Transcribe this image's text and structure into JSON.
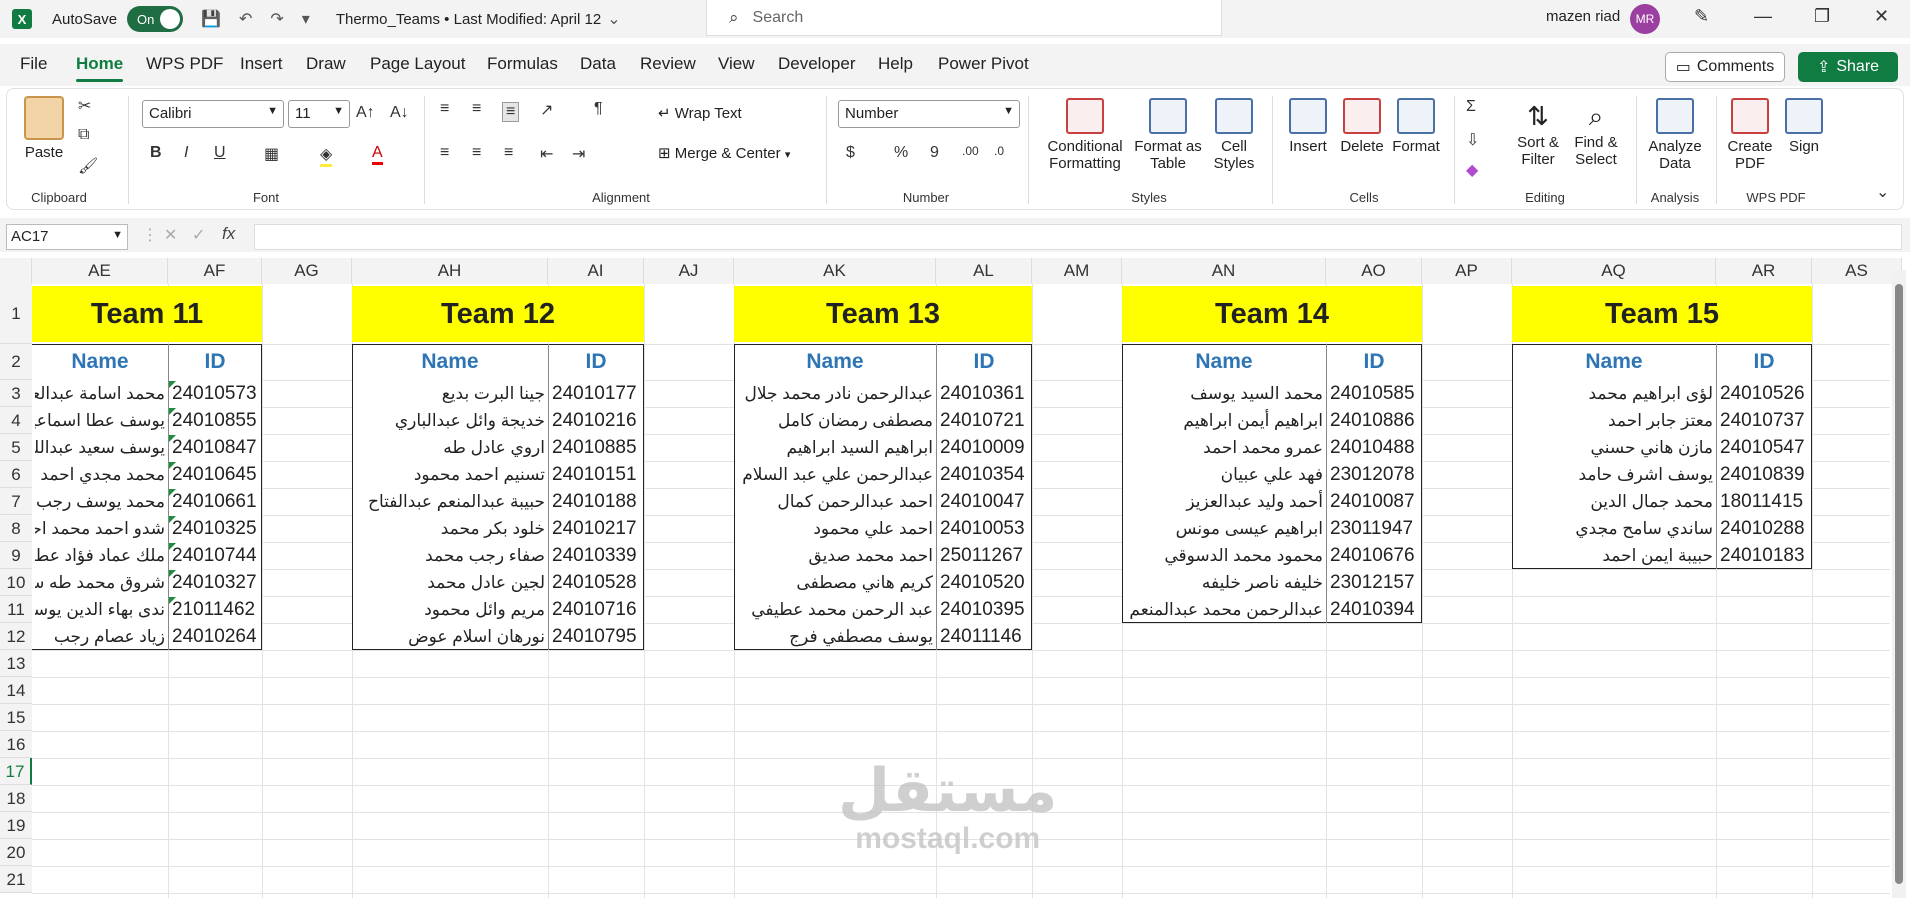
{
  "titlebar": {
    "app_icon": "X",
    "autosave_label": "AutoSave",
    "autosave_state": "On",
    "doc_title": "Thermo_Teams • Last Modified: April 12",
    "search_placeholder": "Search",
    "user_name": "mazen riad",
    "user_initials": "MR"
  },
  "menu": {
    "tabs": [
      "File",
      "Home",
      "WPS PDF",
      "Insert",
      "Draw",
      "Page Layout",
      "Formulas",
      "Data",
      "Review",
      "View",
      "Developer",
      "Help",
      "Power Pivot"
    ],
    "comments_label": "Comments",
    "share_label": "Share"
  },
  "ribbon": {
    "paste": "Paste",
    "clipboard": "Clipboard",
    "font_name": "Calibri",
    "font_size": "11",
    "font_group": "Font",
    "wrap_text": "Wrap Text",
    "merge_center": "Merge & Center",
    "alignment": "Alignment",
    "number_format": "Number",
    "number_group": "Number",
    "conditional_formatting_1": "Conditional",
    "conditional_formatting_2": "Formatting",
    "format_as_table_1": "Format as",
    "format_as_table_2": "Table",
    "cell_styles_1": "Cell",
    "cell_styles_2": "Styles",
    "styles_group": "Styles",
    "insert": "Insert",
    "delete": "Delete",
    "format": "Format",
    "cells_group": "Cells",
    "sort_filter_1": "Sort &",
    "sort_filter_2": "Filter",
    "find_select_1": "Find &",
    "find_select_2": "Select",
    "editing_group": "Editing",
    "analyze_1": "Analyze",
    "analyze_2": "Data",
    "analysis_group": "Analysis",
    "create_pdf_1": "Create",
    "create_pdf_2": "PDF",
    "sign": "Sign",
    "wpspdf_group": "WPS PDF"
  },
  "formula": {
    "name_box": "AC17",
    "fx": "fx",
    "value": ""
  },
  "grid": {
    "columns": [
      "AE",
      "AF",
      "AG",
      "AH",
      "AI",
      "AJ",
      "AK",
      "AL",
      "AM",
      "AN",
      "AO",
      "AP",
      "AQ",
      "AR",
      "AS"
    ],
    "rows": [
      "1",
      "2",
      "3",
      "4",
      "5",
      "6",
      "7",
      "8",
      "9",
      "10",
      "11",
      "12",
      "13",
      "14",
      "15",
      "16",
      "17",
      "18",
      "19",
      "20",
      "21"
    ],
    "name_header": "Name",
    "id_header": "ID"
  },
  "teams": [
    {
      "title": "Team 11",
      "members": [
        {
          "name": "محمد اسامة عبدالعزيز",
          "id": "24010573"
        },
        {
          "name": "يوسف عطا اسماعيل",
          "id": "24010855"
        },
        {
          "name": "يوسف سعيد عبدالله",
          "id": "24010847"
        },
        {
          "name": "محمد مجدي احمد",
          "id": "24010645"
        },
        {
          "name": "محمد يوسف رجب",
          "id": "24010661"
        },
        {
          "name": "شدو احمد محمد احمد",
          "id": "24010325"
        },
        {
          "name": "ملك عماد فؤاد عطا",
          "id": "24010744"
        },
        {
          "name": "شروق محمد طه سالم",
          "id": "24010327"
        },
        {
          "name": "ندى بهاء الدين يوسف",
          "id": "21011462"
        },
        {
          "name": "زياد عصام رجب",
          "id": "24010264"
        }
      ]
    },
    {
      "title": "Team 12",
      "members": [
        {
          "name": "جينا البرت بديع",
          "id": "24010177"
        },
        {
          "name": "خديجة وائل عبدالباري",
          "id": "24010216"
        },
        {
          "name": "اروي عادل طه",
          "id": "24010885"
        },
        {
          "name": "تسنيم احمد محمود",
          "id": "24010151"
        },
        {
          "name": "حبيبة عبدالمنعم عبدالفتاح",
          "id": "24010188"
        },
        {
          "name": "خلود بكر محمد",
          "id": "24010217"
        },
        {
          "name": "صفاء رجب محمد",
          "id": "24010339"
        },
        {
          "name": "لجين عادل محمد",
          "id": "24010528"
        },
        {
          "name": "مريم وائل محمود",
          "id": "24010716"
        },
        {
          "name": "نورهان اسلام عوض",
          "id": "24010795"
        }
      ]
    },
    {
      "title": "Team 13",
      "members": [
        {
          "name": "عبدالرحمن نادر محمد جلال",
          "id": "24010361"
        },
        {
          "name": "مصطفى رمضان كامل",
          "id": "24010721"
        },
        {
          "name": "ابراهيم السيد ابراهيم",
          "id": "24010009"
        },
        {
          "name": "عبدالرحمن علي عبد السلام",
          "id": "24010354"
        },
        {
          "name": "احمد عبدالرحمن كمال",
          "id": "24010047"
        },
        {
          "name": "احمد علي محمود",
          "id": "24010053"
        },
        {
          "name": "احمد محمد صديق",
          "id": "25011267"
        },
        {
          "name": "كريم هاني مصطفى",
          "id": "24010520"
        },
        {
          "name": "عبد الرحمن محمد عطيفي",
          "id": "24010395"
        },
        {
          "name": "يوسف مصطفي فرج",
          "id": "24011146"
        }
      ]
    },
    {
      "title": "Team 14",
      "members": [
        {
          "name": "محمد السيد يوسف",
          "id": "24010585"
        },
        {
          "name": "ابراهيم أيمن ابراهيم",
          "id": "24010886"
        },
        {
          "name": "عمرو محمد احمد",
          "id": "24010488"
        },
        {
          "name": "فهد علي عبيان",
          "id": "23012078"
        },
        {
          "name": "أحمد وليد عبدالعزيز",
          "id": "24010087"
        },
        {
          "name": "ابراهيم عيسى مونس",
          "id": "23011947"
        },
        {
          "name": "محمود محمد الدسوقي",
          "id": "24010676"
        },
        {
          "name": "خليفه ناصر خليفه",
          "id": "23012157"
        },
        {
          "name": "عبدالرحمن محمد عبدالمنعم",
          "id": "24010394"
        }
      ]
    },
    {
      "title": "Team 15",
      "members": [
        {
          "name": "لؤى ابراهيم محمد",
          "id": "24010526"
        },
        {
          "name": "معتز جابر احمد",
          "id": "24010737"
        },
        {
          "name": "مازن هاني حسني",
          "id": "24010547"
        },
        {
          "name": "يوسف اشرف حامد",
          "id": "24010839"
        },
        {
          "name": "محمد جمال الدين",
          "id": "18011415"
        },
        {
          "name": "ساندي سامح مجدي",
          "id": "24010288"
        },
        {
          "name": "حبيبة ايمن احمد",
          "id": "24010183"
        }
      ]
    }
  ],
  "watermark": {
    "arabic": "مستقل",
    "latin": "mostaql.com"
  },
  "colors": {
    "accent": "#107c41",
    "header_blue": "#2e75b6",
    "team_yellow": "#ffff00"
  }
}
